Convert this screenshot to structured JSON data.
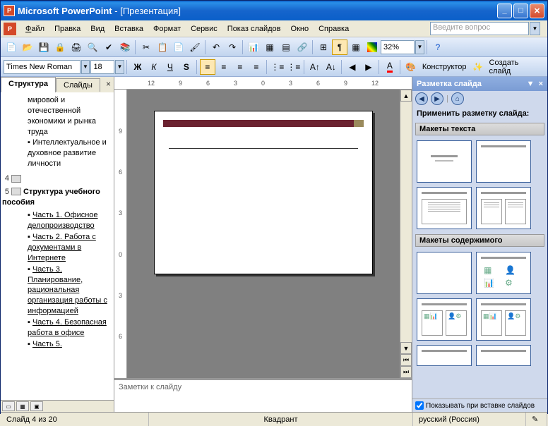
{
  "title": {
    "app": "Microsoft PowerPoint",
    "doc": "[Презентация]"
  },
  "menu": {
    "file": "Файл",
    "edit": "Правка",
    "view": "Вид",
    "insert": "Вставка",
    "format": "Формат",
    "tools": "Сервис",
    "slideshow": "Показ слайдов",
    "window": "Окно",
    "help": "Справка"
  },
  "helpbox": "Введите вопрос",
  "toolbar1": {
    "zoom": "32%"
  },
  "toolbar2": {
    "font": "Times New Roman",
    "size": "18",
    "designer": "Конструктор",
    "newslide": "Создать слайд"
  },
  "tabs": {
    "outline": "Структура",
    "slides": "Слайды"
  },
  "outline": {
    "b1": "мировой и отечественной экономики и рынка труда",
    "b2": "Интеллектуальное и духовное развитие личности",
    "n4": "4",
    "n5": "5",
    "t5": "Структура учебного пособия",
    "c1": "Часть 1. Офисное делопроизводство",
    "c2": "Часть 2. Работа с документами в Интернете",
    "c3": "Часть 3. Планирование, рациональная организация работы с информацией",
    "c4": "Часть 4. Безопасная работа в офисе",
    "c5": "Часть 5."
  },
  "ruler": {
    "m12": "12",
    "m9": "9",
    "m6": "6",
    "m3": "3",
    "m0": "0",
    "p3": "3",
    "p6": "6",
    "p9": "9",
    "p12": "12"
  },
  "rulerv": {
    "a": "9",
    "b": "6",
    "c": "3",
    "d": "0",
    "e": "3",
    "f": "6"
  },
  "notes": "Заметки к слайду",
  "rpane": {
    "title": "Разметка слайда",
    "apply": "Применить разметку слайда:",
    "sect1": "Макеты текста",
    "sect2": "Макеты содержимого",
    "footer": "Показывать при вставке слайдов"
  },
  "status": {
    "slide": "Слайд 4 из 20",
    "center": "Квадрант",
    "lang": "русский (Россия)"
  }
}
